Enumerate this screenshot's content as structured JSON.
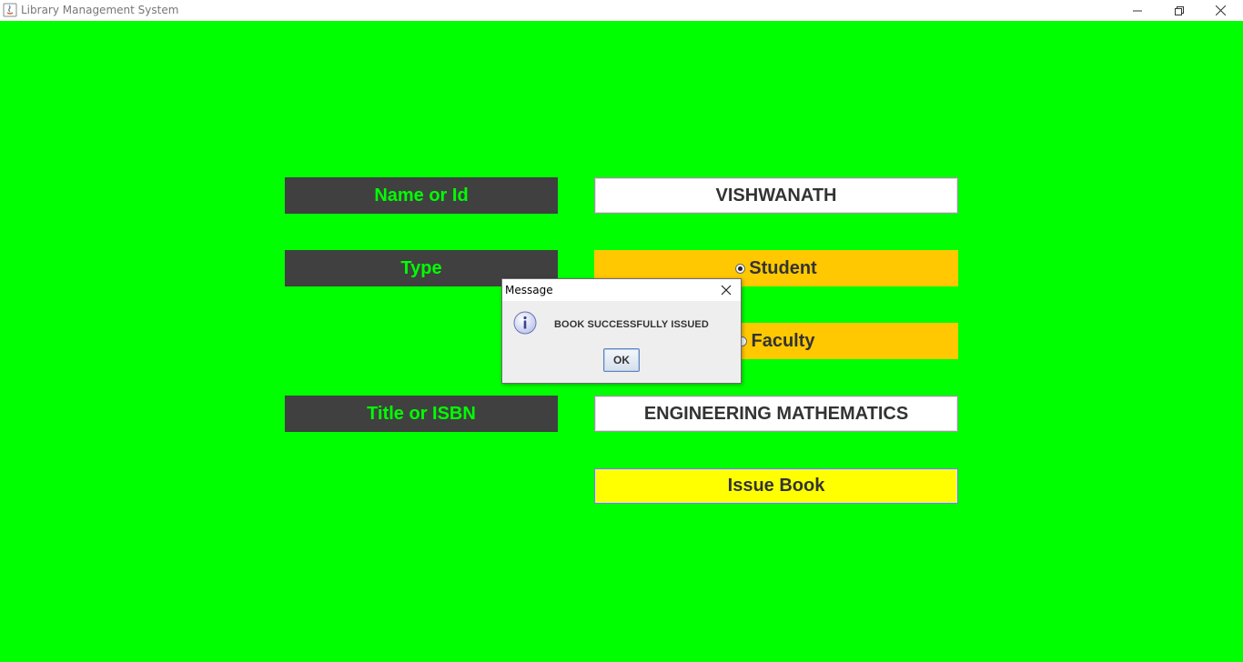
{
  "window": {
    "title": "Library Management System",
    "icon": "java-icon"
  },
  "form": {
    "name_label": "Name or Id",
    "name_value": "VISHWANATH",
    "type_label": "Type",
    "type_options": [
      "Student",
      "Faculty"
    ],
    "type_selected": "Student",
    "title_label": "Title or ISBN",
    "title_value": "ENGINEERING MATHEMATICS",
    "issue_button": "Issue Book"
  },
  "dialog": {
    "title": "Message",
    "message": "BOOK SUCCESSFULLY ISSUED",
    "ok_label": "OK",
    "icon": "info-icon"
  },
  "colors": {
    "background": "#00ff00",
    "label_bg": "#404040",
    "label_text": "#00ff00",
    "radio_bg": "#ffc800",
    "button_bg": "#ffff00"
  }
}
